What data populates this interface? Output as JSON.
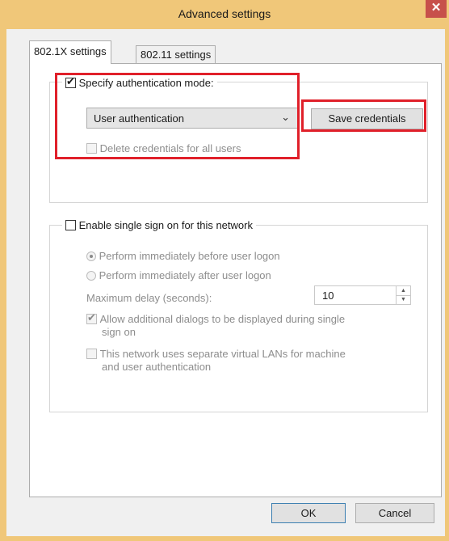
{
  "window": {
    "title": "Advanced settings",
    "close_glyph": "✕"
  },
  "tabs": [
    {
      "label": "802.1X settings",
      "active": true
    },
    {
      "label": "802.11 settings",
      "active": false
    }
  ],
  "auth_group": {
    "checkbox_label": "Specify authentication mode:",
    "checked": true,
    "mode_value": "User authentication",
    "save_credentials_label": "Save credentials",
    "delete_credentials_label": "Delete credentials for all users",
    "delete_credentials_checked": false
  },
  "sso_group": {
    "checkbox_label": "Enable single sign on for this network",
    "checked": false,
    "radio_before_label": "Perform immediately before user logon",
    "radio_before_selected": true,
    "radio_after_label": "Perform immediately after user logon",
    "radio_after_selected": false,
    "max_delay_label": "Maximum delay (seconds):",
    "max_delay_value": "10",
    "allow_dialogs_label_line1": "Allow additional dialogs to be displayed during single",
    "allow_dialogs_label_line2": "sign on",
    "allow_dialogs_checked": true,
    "vlan_label_line1": "This network uses separate virtual LANs for machine",
    "vlan_label_line2": "and user authentication",
    "vlan_checked": false
  },
  "footer": {
    "ok_label": "OK",
    "cancel_label": "Cancel"
  },
  "glyphs": {
    "check": "✔",
    "dropdown": "⌄",
    "spin_up": "▲",
    "spin_down": "▼"
  },
  "colors": {
    "titlebar": "#f0c779",
    "close_button": "#c7504b",
    "highlight": "#e0202a"
  }
}
